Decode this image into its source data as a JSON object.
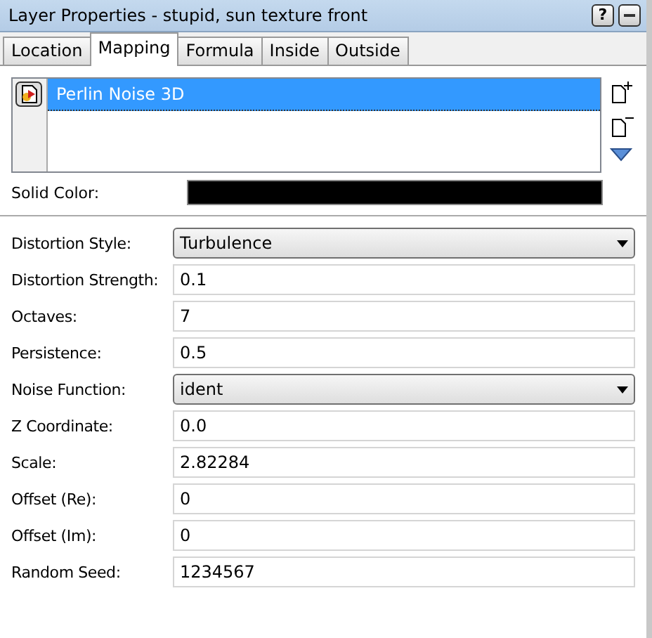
{
  "window": {
    "title": "Layer Properties - stupid, sun texture front",
    "help": "?"
  },
  "tabs": [
    {
      "label": "Location",
      "selected": false
    },
    {
      "label": "Mapping",
      "selected": true
    },
    {
      "label": "Formula",
      "selected": false
    },
    {
      "label": "Inside",
      "selected": false
    },
    {
      "label": "Outside",
      "selected": false
    }
  ],
  "mappings": [
    {
      "name": "Perlin Noise 3D",
      "selected": true
    }
  ],
  "solid_color": {
    "label": "Solid Color:",
    "color": "#000000"
  },
  "fields": [
    {
      "kind": "select",
      "label": "Distortion Style:",
      "value": "Turbulence"
    },
    {
      "kind": "text",
      "label": "Distortion Strength:",
      "value": "0.1"
    },
    {
      "kind": "text",
      "label": "Octaves:",
      "value": "7"
    },
    {
      "kind": "text",
      "label": "Persistence:",
      "value": "0.5"
    },
    {
      "kind": "select",
      "label": "Noise Function:",
      "value": "ident"
    },
    {
      "kind": "text",
      "label": "Z Coordinate:",
      "value": "0.0"
    },
    {
      "kind": "text",
      "label": "Scale:",
      "value": "2.82284"
    },
    {
      "kind": "text",
      "label": "Offset (Re):",
      "value": "0"
    },
    {
      "kind": "text",
      "label": "Offset (Im):",
      "value": "0"
    },
    {
      "kind": "text",
      "label": "Random Seed:",
      "value": "1234567"
    }
  ]
}
